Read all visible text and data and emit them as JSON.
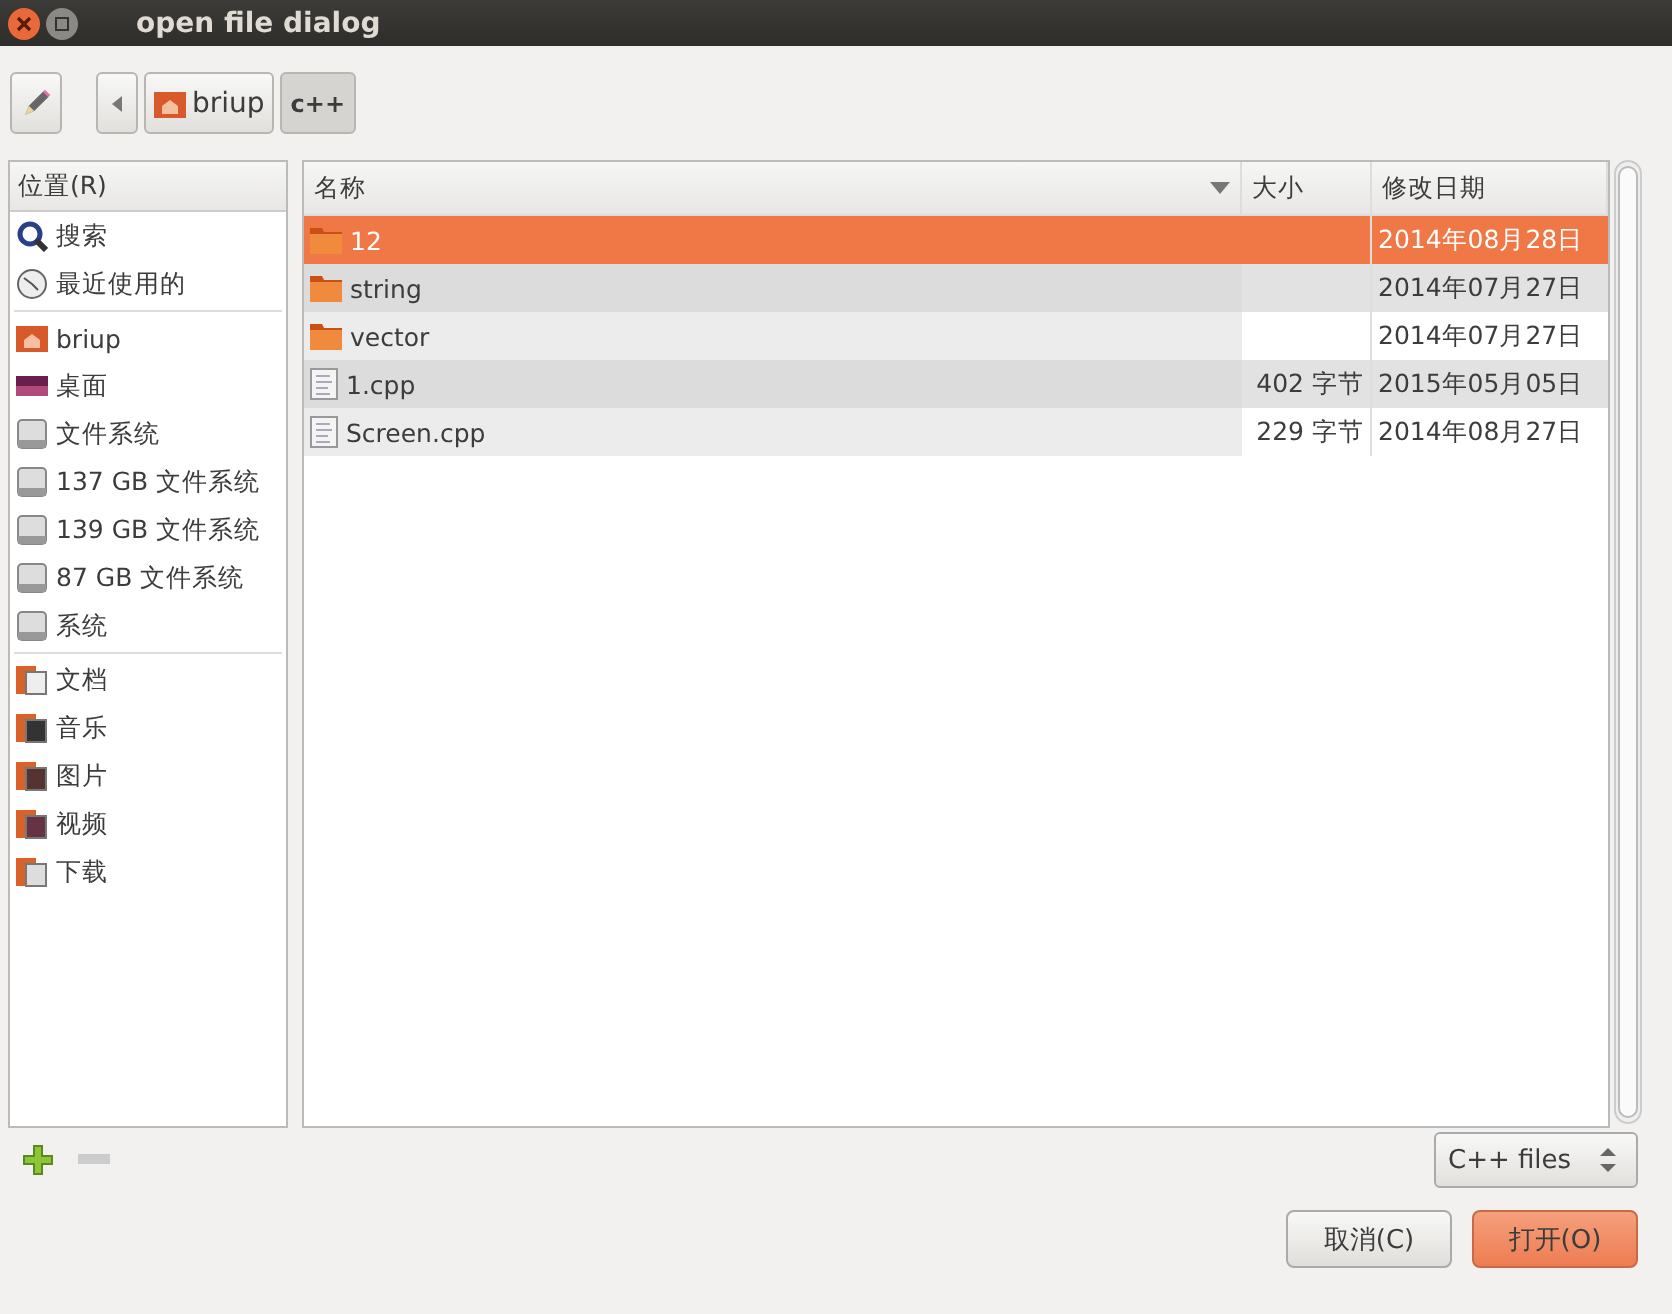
{
  "window": {
    "title": "open file dialog"
  },
  "path_bar": {
    "crumbs": [
      {
        "label": "briup",
        "kind": "home",
        "selected": false
      },
      {
        "label": "c++",
        "kind": "plain",
        "selected": true
      }
    ]
  },
  "places": {
    "header": "位置(R)",
    "groups": [
      [
        {
          "label": "搜索",
          "kind": "search"
        },
        {
          "label": "最近使用的",
          "kind": "recent"
        }
      ],
      [
        {
          "label": "briup",
          "kind": "home"
        },
        {
          "label": "桌面",
          "kind": "desktop"
        },
        {
          "label": "文件系统",
          "kind": "drive"
        },
        {
          "label": "137 GB 文件系统",
          "kind": "drive"
        },
        {
          "label": "139 GB 文件系统",
          "kind": "drive"
        },
        {
          "label": "87 GB 文件系统",
          "kind": "drive"
        },
        {
          "label": "系统",
          "kind": "drive"
        }
      ],
      [
        {
          "label": "文档",
          "kind": "docs"
        },
        {
          "label": "音乐",
          "kind": "music"
        },
        {
          "label": "图片",
          "kind": "pictures"
        },
        {
          "label": "视频",
          "kind": "video"
        },
        {
          "label": "下载",
          "kind": "download"
        }
      ]
    ]
  },
  "files": {
    "columns": [
      "名称",
      "大小",
      "修改日期"
    ],
    "rows": [
      {
        "name": "12",
        "kind": "folder",
        "size": "",
        "modified": "2014年08月28日",
        "selected": true
      },
      {
        "name": "string",
        "kind": "folder",
        "size": "",
        "modified": "2014年07月27日",
        "selected": false
      },
      {
        "name": "vector",
        "kind": "folder",
        "size": "",
        "modified": "2014年07月27日",
        "selected": false
      },
      {
        "name": "1.cpp",
        "kind": "file",
        "size": "402 字节",
        "modified": "2015年05月05日",
        "selected": false
      },
      {
        "name": "Screen.cpp",
        "kind": "file",
        "size": "229 字节",
        "modified": "2014年08月27日",
        "selected": false
      }
    ]
  },
  "filter": {
    "value": "C++ files"
  },
  "buttons": [
    {
      "label": "取消(C)",
      "kind": "cancel"
    },
    {
      "label": "打开(O)",
      "kind": "primary"
    }
  ]
}
